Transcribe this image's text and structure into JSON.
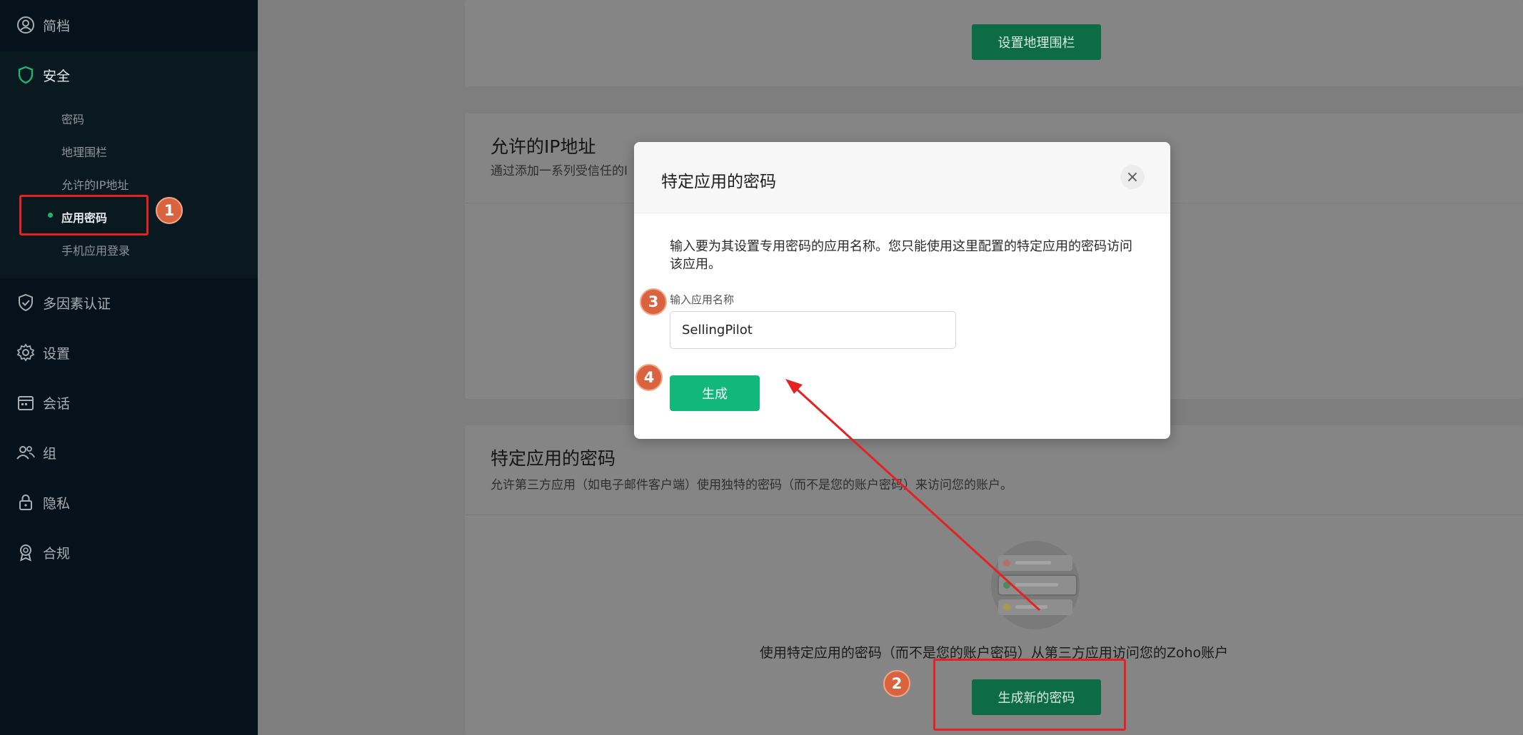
{
  "sidebar": {
    "items": [
      {
        "label": "简档",
        "icon": "user-circle-icon"
      },
      {
        "label": "安全",
        "icon": "shield-icon"
      },
      {
        "label": "多因素认证",
        "icon": "shield-check-icon"
      },
      {
        "label": "设置",
        "icon": "gear-icon"
      },
      {
        "label": "会话",
        "icon": "calendar-icon"
      },
      {
        "label": "组",
        "icon": "group-icon"
      },
      {
        "label": "隐私",
        "icon": "lock-icon"
      },
      {
        "label": "合规",
        "icon": "award-icon"
      }
    ],
    "security_sub": [
      "密码",
      "地理围栏",
      "允许的IP地址",
      "应用密码",
      "手机应用登录"
    ]
  },
  "cards": {
    "geofence_button": "设置地理围栏",
    "ip": {
      "title": "允许的IP地址",
      "desc": "通过添加一系列受信任的I"
    },
    "app_password": {
      "title": "特定应用的密码",
      "desc": "允许第三方应用（如电子邮件客户端）使用独特的密码（而不是您的账户密码）来访问您的账户。",
      "empty_text": "使用特定应用的密码（而不是您的账户密码）从第三方应用访问您的Zoho账户",
      "button": "生成新的密码"
    }
  },
  "modal": {
    "title": "特定应用的密码",
    "close": "×",
    "desc": "输入要为其设置专用密码的应用名称。您只能使用这里配置的特定应用的密码访问该应用。",
    "field_label": "输入应用名称",
    "field_value": "SellingPilot",
    "button": "生成"
  },
  "annotations": [
    "1",
    "2",
    "3",
    "4"
  ],
  "colors": {
    "accent": "#12b77b",
    "annotation": "#e52222",
    "badge": "#d9633f"
  }
}
